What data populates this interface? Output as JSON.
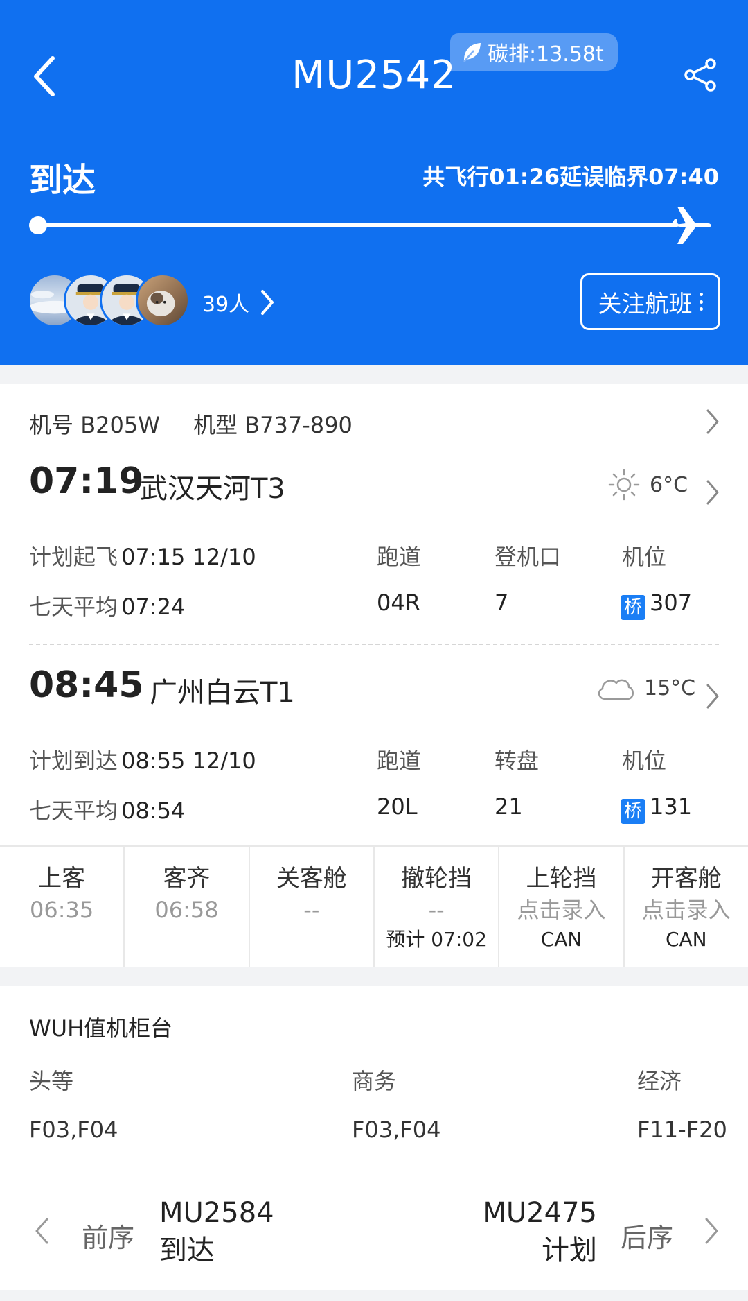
{
  "header": {
    "flight_no": "MU2542",
    "carbon": "碳排:13.58t",
    "status": "到达",
    "fly_info": "共飞行01:26延误临界07:40",
    "followers": "39人",
    "follow_label": "关注航班",
    "progress": 1.0,
    "accent": "#1070f0"
  },
  "aircraft": {
    "reg_label": "机号",
    "reg": "B205W",
    "type_label": "机型",
    "type": "B737-890"
  },
  "departure": {
    "time": "07:19",
    "airport": "武汉天河T3",
    "weather_icon": "sun-icon",
    "temp": "6°C",
    "plan_label": "计划起飞",
    "plan_value": "07:15 12/10",
    "avg_label": "七天平均",
    "avg_value": "07:24",
    "runway_label": "跑道",
    "runway": "04R",
    "gate_label": "登机口",
    "gate": "7",
    "stand_label": "机位",
    "stand_tag": "桥",
    "stand": "307"
  },
  "arrival": {
    "time": "08:45",
    "airport": "广州白云T1",
    "weather_icon": "cloud-icon",
    "temp": "15°C",
    "plan_label": "计划到达",
    "plan_value": "08:55 12/10",
    "avg_label": "七天平均",
    "avg_value": "08:54",
    "runway_label": "跑道",
    "runway": "20L",
    "carousel_label": "转盘",
    "carousel": "21",
    "stand_label": "机位",
    "stand_tag": "桥",
    "stand": "131"
  },
  "steps": [
    {
      "name": "上客",
      "time": "06:35",
      "note": ""
    },
    {
      "name": "客齐",
      "time": "06:58",
      "note": ""
    },
    {
      "name": "关客舱",
      "time": "--",
      "note": ""
    },
    {
      "name": "撤轮挡",
      "time": "--",
      "note": "预计 07:02"
    },
    {
      "name": "上轮挡",
      "time": "点击录入",
      "note": "CAN"
    },
    {
      "name": "开客舱",
      "time": "点击录入",
      "note": "CAN"
    }
  ],
  "checkin": {
    "title": "WUH值机柜台",
    "first_label": "头等",
    "first_value": "F03,F04",
    "business_label": "商务",
    "business_value": "F03,F04",
    "economy_label": "经济",
    "economy_value": "F11-F20"
  },
  "nav": {
    "prev_label": "前序",
    "prev_flight": "MU2584",
    "prev_status": "到达",
    "next_label": "后序",
    "next_flight": "MU2475",
    "next_status": "计划"
  }
}
